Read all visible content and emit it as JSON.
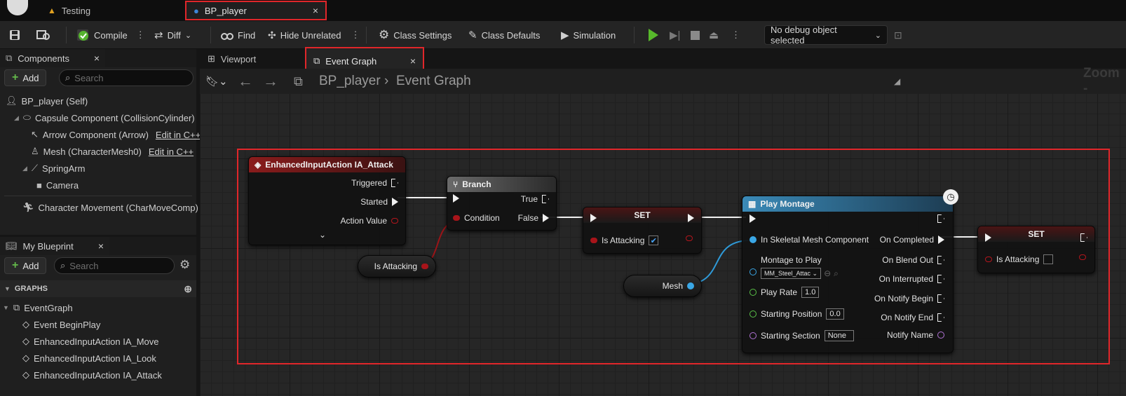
{
  "tabs": {
    "testing": "Testing",
    "bp_player": "BP_player"
  },
  "toolbar": {
    "compile": "Compile",
    "diff": "Diff",
    "find": "Find",
    "hide_unrelated": "Hide Unrelated",
    "class_settings": "Class Settings",
    "class_defaults": "Class Defaults",
    "simulation": "Simulation",
    "debug_object": "No debug object selected"
  },
  "components_panel": {
    "title": "Components",
    "add_label": "Add",
    "search_placeholder": "Search",
    "items": [
      {
        "label": "BP_player (Self)"
      },
      {
        "label": "Capsule Component (CollisionCylinder)"
      },
      {
        "label": "Arrow Component (Arrow)",
        "link": "Edit in C++"
      },
      {
        "label": "Mesh (CharacterMesh0)",
        "link": "Edit in C++"
      },
      {
        "label": "SpringArm"
      },
      {
        "label": "Camera"
      },
      {
        "label": "Character Movement (CharMoveComp)"
      }
    ]
  },
  "my_blueprint": {
    "title": "My Blueprint",
    "add_label": "Add",
    "search_placeholder": "Search",
    "graphs_header": "GRAPHS",
    "graph_name": "EventGraph",
    "events": [
      "Event BeginPlay",
      "EnhancedInputAction IA_Move",
      "EnhancedInputAction IA_Look",
      "EnhancedInputAction IA_Attack"
    ]
  },
  "editor_tabs": {
    "viewport": "Viewport",
    "event_graph": "Event Graph"
  },
  "graph": {
    "breadcrumb_root": "BP_player",
    "breadcrumb_leaf": "Event Graph",
    "zoom_label": "Zoom -",
    "input_node": {
      "title": "EnhancedInputAction IA_Attack",
      "triggered": "Triggered",
      "started": "Started",
      "action_value": "Action Value"
    },
    "branch_node": {
      "title": "Branch",
      "true_label": "True",
      "false_label": "False",
      "condition": "Condition"
    },
    "is_attacking_getter": "Is Attacking",
    "set_node_1": {
      "title": "SET",
      "var": "Is Attacking",
      "checked": true
    },
    "mesh_getter": "Mesh",
    "montage_node": {
      "title": "Play Montage",
      "in_skeletal": "In Skeletal Mesh Component",
      "montage_to_play": "Montage to Play",
      "montage_value": "MM_Steel_Attac",
      "play_rate": "Play Rate",
      "play_rate_val": "1.0",
      "starting_position": "Starting Position",
      "starting_position_val": "0.0",
      "starting_section": "Starting Section",
      "starting_section_val": "None",
      "on_completed": "On Completed",
      "on_blend_out": "On Blend Out",
      "on_interrupted": "On Interrupted",
      "on_notify_begin": "On Notify Begin",
      "on_notify_end": "On Notify End",
      "notify_name": "Notify Name"
    },
    "set_node_2": {
      "title": "SET",
      "var": "Is Attacking",
      "checked": false
    }
  },
  "colors": {
    "highlight": "#e0262a",
    "event_header": "#8a1c1c",
    "exec_wire": "#f0f0f0",
    "bool_wire": "#9a1418",
    "object_wire": "#2f9ad8",
    "play_green": "#57b82b"
  }
}
